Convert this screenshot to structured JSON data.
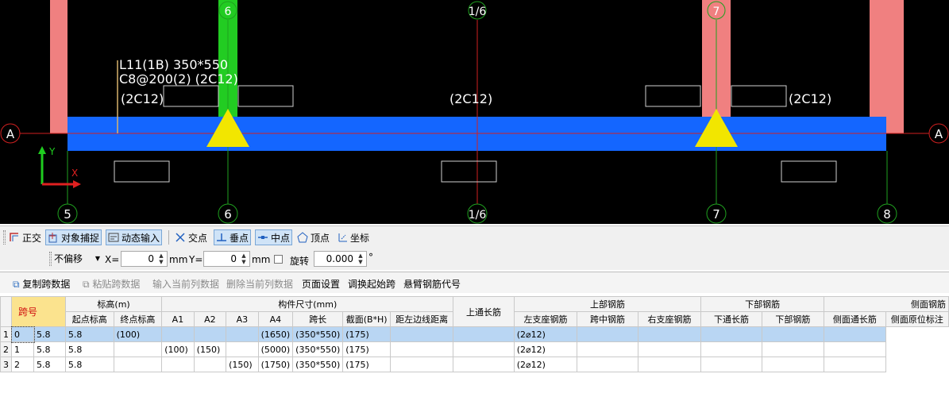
{
  "canvas": {
    "beam_label_line1": "L11(1B) 350*550",
    "beam_label_line2": "C8@200(2) (2C12)",
    "rebar_left": "(2C12)",
    "rebar_mid": "(2C12)",
    "rebar_right": "(2C12)",
    "axis_row": "A",
    "axes_bottom": [
      "5",
      "6",
      "1/6",
      "7",
      "8"
    ],
    "axes_top": [
      "6",
      "1/6",
      "7"
    ],
    "ucs_y": "Y",
    "ucs_x": "X",
    "colors": {
      "beam": "#1466ff",
      "column": "#f08080",
      "selected_column": "#22cc22",
      "support": "#f2e600",
      "axis": "#1fa01f",
      "axis_row_line": "#d02020"
    }
  },
  "snapbar": {
    "ortho": "正交",
    "object_snap": "对象捕捉",
    "dynamic_input": "动态输入",
    "intersection": "交点",
    "perpendicular": "垂点",
    "midpoint": "中点",
    "vertex": "顶点",
    "coordinate": "坐标"
  },
  "offsetbar": {
    "offset_mode": "不偏移",
    "x_label": "X=",
    "x_value": "0",
    "x_unit": "mm",
    "y_label": "Y=",
    "y_value": "0",
    "y_unit": "mm",
    "rotate_label": "旋转",
    "rotate_value": "0.000",
    "rotate_unit": "°"
  },
  "grid_tools": {
    "copy_span": "复制跨数据",
    "paste_span": "粘贴跨数据",
    "input_column": "输入当前列数据",
    "delete_column": "删除当前列数据",
    "page_setup": "页面设置",
    "adjust_start_span": "调换起始跨",
    "cantilever_code": "悬臂钢筋代号"
  },
  "grid": {
    "header_groups": {
      "span_no": "跨号",
      "elevation": "标高(m)",
      "dimensions": "构件尺寸(mm)",
      "top_through": "上通长筋",
      "top_rebar": "上部钢筋",
      "bottom_rebar": "下部钢筋",
      "side_rebar": "侧面钢筋"
    },
    "sub_headers": {
      "start_elev": "起点标高",
      "end_elev": "终点标高",
      "a1": "A1",
      "a2": "A2",
      "a3": "A3",
      "a4": "A4",
      "span_len": "跨长",
      "section": "截面(B*H)",
      "left_dist": "距左边线距离",
      "left_support": "左支座钢筋",
      "mid_span": "跨中钢筋",
      "right_support": "右支座钢筋",
      "bottom_through": "下通长筋",
      "bottom": "下部钢筋",
      "side_through": "侧面通长筋",
      "side_local": "侧面原位标注"
    },
    "rows": [
      {
        "rn": "1",
        "span": "0",
        "start": "5.8",
        "end": "5.8",
        "a1": "(100)",
        "a2": "",
        "a3": "",
        "a4": "",
        "len": "(1650)",
        "sec": "(350*550)",
        "dist": "(175)",
        "top": "",
        "ls": "",
        "mid": "(2⌀12)",
        "rs": "",
        "bt": "",
        "b": "",
        "st": "",
        "sl": ""
      },
      {
        "rn": "2",
        "span": "1",
        "start": "5.8",
        "end": "5.8",
        "a1": "",
        "a2": "(100)",
        "a3": "(150)",
        "a4": "",
        "len": "(5000)",
        "sec": "(350*550)",
        "dist": "(175)",
        "top": "",
        "ls": "",
        "mid": "(2⌀12)",
        "rs": "",
        "bt": "",
        "b": "",
        "st": "",
        "sl": ""
      },
      {
        "rn": "3",
        "span": "2",
        "start": "5.8",
        "end": "5.8",
        "a1": "",
        "a2": "",
        "a3": "",
        "a4": "(150)",
        "len": "(1750)",
        "sec": "(350*550)",
        "dist": "(175)",
        "top": "",
        "ls": "",
        "mid": "(2⌀12)",
        "rs": "",
        "bt": "",
        "b": "",
        "st": "",
        "sl": ""
      }
    ]
  }
}
